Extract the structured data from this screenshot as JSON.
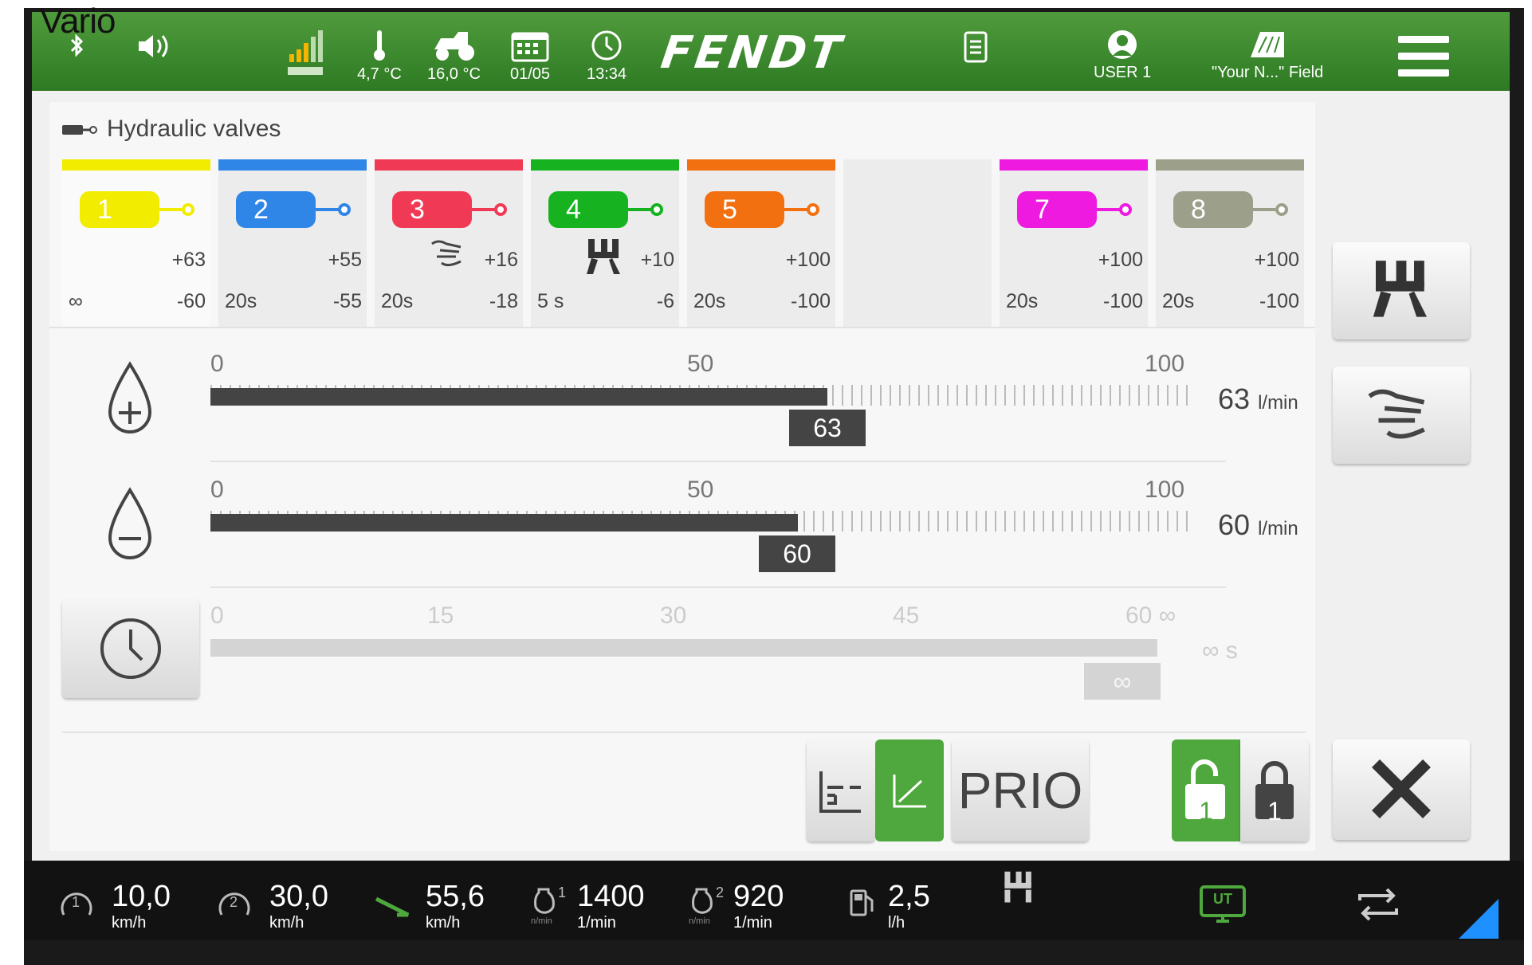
{
  "app_label": "Vario",
  "topbar": {
    "temp_outside": "4,7 °C",
    "temp_tractor": "16,0 °C",
    "date": "01/05",
    "time": "13:34",
    "brand": "FENDT",
    "user": "USER 1",
    "field": "\"Your N...\" Field"
  },
  "panel": {
    "title": "Hydraulic valves"
  },
  "valves": [
    {
      "number": "1",
      "color": "#f2ec00",
      "plus": "+63",
      "minus": "-60",
      "time": "∞",
      "icon": ""
    },
    {
      "number": "2",
      "color": "#2f86e6",
      "plus": "+55",
      "minus": "-55",
      "time": "20s",
      "icon": ""
    },
    {
      "number": "3",
      "color": "#f03a55",
      "plus": "+16",
      "minus": "-18",
      "time": "20s",
      "icon": "hand-touch-icon"
    },
    {
      "number": "4",
      "color": "#17b21f",
      "plus": "+10",
      "minus": "-6",
      "time": "5 s",
      "icon": "tractor-hitch-icon"
    },
    {
      "number": "5",
      "color": "#f27010",
      "plus": "+100",
      "minus": "-100",
      "time": "20s",
      "icon": ""
    },
    {
      "number": "7",
      "color": "#ee1adf",
      "plus": "+100",
      "minus": "-100",
      "time": "20s",
      "icon": ""
    },
    {
      "number": "8",
      "color": "#9c9f8a",
      "plus": "+100",
      "minus": "-100",
      "time": "20s",
      "icon": ""
    }
  ],
  "flow_plus": {
    "scale": [
      "0",
      "50",
      "100"
    ],
    "value": "63",
    "level_percent": 63,
    "readout": "63",
    "unit": "l/min"
  },
  "flow_minus": {
    "scale": [
      "0",
      "50",
      "100"
    ],
    "value": "60",
    "level_percent": 60,
    "readout": "60",
    "unit": "l/min"
  },
  "timer": {
    "scale": [
      "0",
      "15",
      "30",
      "45",
      "60 ∞"
    ],
    "value": "∞",
    "readout": "∞ s"
  },
  "controls": {
    "prio_label": "PRIO",
    "lock_unlocked_number": "1",
    "lock_locked_number": "1"
  },
  "bottombar": {
    "speed1": {
      "value": "10,0",
      "unit": "km/h",
      "icon_label": "1"
    },
    "speed2": {
      "value": "30,0",
      "unit": "km/h",
      "icon_label": "2"
    },
    "speed_pedal": {
      "value": "55,6",
      "unit": "km/h"
    },
    "rpm1": {
      "value": "1400",
      "unit": "1/min",
      "icon_label": "1",
      "icon_sub": "n/min"
    },
    "rpm2": {
      "value": "920",
      "unit": "1/min",
      "icon_label": "2",
      "icon_sub": "n/min"
    },
    "fuel": {
      "value": "2,5",
      "unit": "l/h"
    },
    "ut_label": "UT"
  }
}
